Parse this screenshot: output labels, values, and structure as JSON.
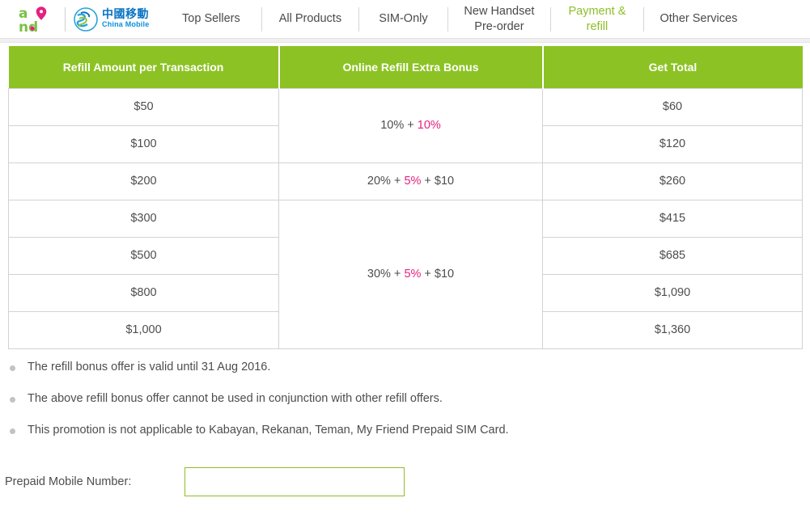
{
  "brand": {
    "and_logo_alt": "and",
    "china_mobile_cn": "中國移動",
    "china_mobile_en": "China Mobile",
    "colors": {
      "green": "#8cc224",
      "nav_active_green": "#8cbf26",
      "pink": "#e5207e",
      "blue": "#0a8fd8",
      "text": "#4d4d4d"
    }
  },
  "nav": {
    "items": [
      {
        "label": "Top Sellers",
        "active": false
      },
      {
        "label": "All Products",
        "active": false
      },
      {
        "label": "SIM-Only",
        "active": false
      },
      {
        "label": "New Handset\nPre-order",
        "active": false
      },
      {
        "label": "Payment &\nrefill",
        "active": true
      },
      {
        "label": "Other Services",
        "active": false
      }
    ]
  },
  "table": {
    "headers": [
      "Refill Amount per Transaction",
      "Online Refill Extra Bonus",
      "Get Total"
    ],
    "rows": [
      {
        "amount": "$50",
        "total": "$60"
      },
      {
        "amount": "$100",
        "total": "$120"
      },
      {
        "amount": "$200",
        "total": "$260"
      },
      {
        "amount": "$300",
        "total": "$415"
      },
      {
        "amount": "$500",
        "total": "$685"
      },
      {
        "amount": "$800",
        "total": "$1,090"
      },
      {
        "amount": "$1,000",
        "total": "$1,360"
      }
    ],
    "bonuses": [
      {
        "rowspan": 2,
        "base": "10%",
        "plus1": " + ",
        "pink": "10%",
        "tail": ""
      },
      {
        "rowspan": 1,
        "base": "20%",
        "plus1": " + ",
        "pink": "5%",
        "tail": " + $10"
      },
      {
        "rowspan": 4,
        "base": "30%",
        "plus1": " + ",
        "pink": "5%",
        "tail": " + $10"
      }
    ]
  },
  "notes": [
    "The refill bonus offer is valid until 31 Aug 2016.",
    "The above refill bonus offer cannot be used in conjunction with other refill offers.",
    "This promotion is not applicable to Kabayan, Rekanan, Teman, My Friend Prepaid SIM Card."
  ],
  "form": {
    "mobile_label": "Prepaid Mobile Number:",
    "mobile_value": "",
    "mobile_placeholder": ""
  }
}
